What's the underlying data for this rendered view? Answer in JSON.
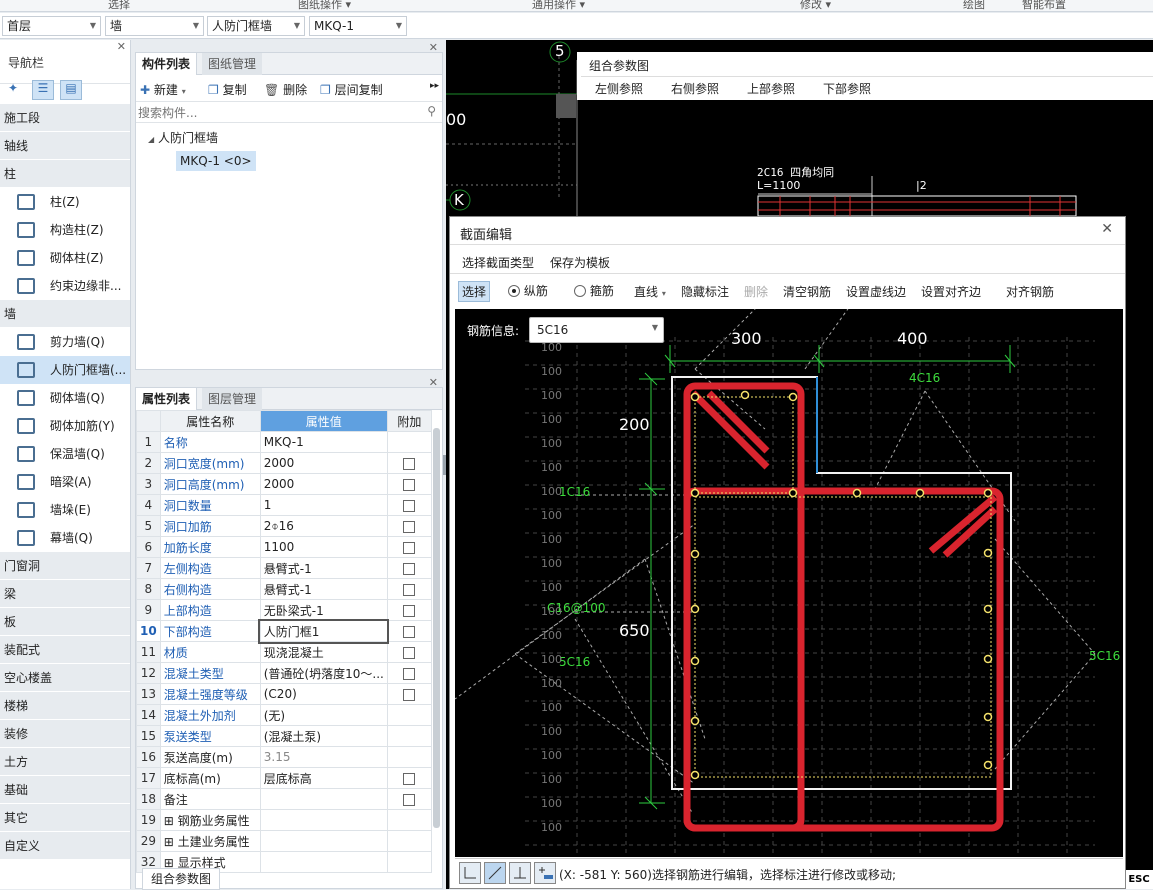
{
  "ribbon": [
    "选择",
    "图纸操作 ▾",
    "通用操作 ▾",
    "修改 ▾",
    "绘图",
    "智能布置"
  ],
  "selectors": {
    "floor": "首层",
    "category": "墙",
    "type": "人防门框墙",
    "instance": "MKQ-1"
  },
  "nav": {
    "title": "导航栏",
    "items": [
      {
        "kind": "sec",
        "label": "施工段"
      },
      {
        "kind": "sec",
        "label": "轴线"
      },
      {
        "kind": "sec",
        "label": "柱"
      },
      {
        "kind": "item",
        "label": "柱(Z)",
        "icon": "column-icon"
      },
      {
        "kind": "item",
        "label": "构造柱(Z)",
        "icon": "constructional-column-icon"
      },
      {
        "kind": "item",
        "label": "砌体柱(Z)",
        "icon": "masonry-column-icon"
      },
      {
        "kind": "item",
        "label": "约束边缘非...",
        "icon": "edge-member-icon"
      },
      {
        "kind": "sec",
        "label": "墙"
      },
      {
        "kind": "item",
        "label": "剪力墙(Q)",
        "icon": "shear-wall-icon"
      },
      {
        "kind": "item",
        "label": "人防门框墙(...",
        "icon": "civil-defense-door-wall-icon",
        "selected": true
      },
      {
        "kind": "item",
        "label": "砌体墙(Q)",
        "icon": "masonry-wall-icon"
      },
      {
        "kind": "item",
        "label": "砌体加筋(Y)",
        "icon": "masonry-rebar-icon"
      },
      {
        "kind": "item",
        "label": "保温墙(Q)",
        "icon": "insulation-wall-icon"
      },
      {
        "kind": "item",
        "label": "暗梁(A)",
        "icon": "hidden-beam-icon"
      },
      {
        "kind": "item",
        "label": "墙垛(E)",
        "icon": "wall-pier-icon"
      },
      {
        "kind": "item",
        "label": "幕墙(Q)",
        "icon": "curtain-wall-icon"
      },
      {
        "kind": "sec",
        "label": "门窗洞"
      },
      {
        "kind": "sec",
        "label": "梁"
      },
      {
        "kind": "sec",
        "label": "板"
      },
      {
        "kind": "sec",
        "label": "装配式"
      },
      {
        "kind": "sec",
        "label": "空心楼盖"
      },
      {
        "kind": "sec",
        "label": "楼梯"
      },
      {
        "kind": "sec",
        "label": "装修"
      },
      {
        "kind": "sec",
        "label": "土方"
      },
      {
        "kind": "sec",
        "label": "基础"
      },
      {
        "kind": "sec",
        "label": "其它"
      },
      {
        "kind": "sec",
        "label": "自定义"
      }
    ]
  },
  "components": {
    "tabs": [
      "构件列表",
      "图纸管理"
    ],
    "toolbar": [
      "新建",
      "复制",
      "删除",
      "层间复制"
    ],
    "search_placeholder": "搜索构件...",
    "tree_parent": "人防门框墙",
    "tree_child": "MKQ-1 <0>"
  },
  "properties": {
    "tabs": [
      "属性列表",
      "图层管理"
    ],
    "headers": [
      "属性名称",
      "属性值",
      "附加"
    ],
    "rows": [
      {
        "n": "1",
        "k": "名称",
        "v": "MKQ-1",
        "blue": true,
        "cb": false
      },
      {
        "n": "2",
        "k": "洞口宽度(mm)",
        "v": "2000",
        "blue": true,
        "cb": true
      },
      {
        "n": "3",
        "k": "洞口高度(mm)",
        "v": "2000",
        "blue": true,
        "cb": true
      },
      {
        "n": "4",
        "k": "洞口数量",
        "v": "1",
        "blue": true,
        "cb": true
      },
      {
        "n": "5",
        "k": "洞口加筋",
        "v": "2⌽16",
        "blue": true,
        "cb": true
      },
      {
        "n": "6",
        "k": "加筋长度",
        "v": "1100",
        "blue": true,
        "cb": true
      },
      {
        "n": "7",
        "k": "左侧构造",
        "v": "悬臂式-1",
        "blue": true,
        "cb": true
      },
      {
        "n": "8",
        "k": "右侧构造",
        "v": "悬臂式-1",
        "blue": true,
        "cb": true
      },
      {
        "n": "9",
        "k": "上部构造",
        "v": "无卧梁式-1",
        "blue": true,
        "cb": true
      },
      {
        "n": "10",
        "k": "下部构造",
        "v": "人防门框1",
        "blue": true,
        "cb": true,
        "edit": true
      },
      {
        "n": "11",
        "k": "材质",
        "v": "现浇混凝土",
        "blue": true,
        "cb": true
      },
      {
        "n": "12",
        "k": "混凝土类型",
        "v": "(普通砼(坍落度10～...",
        "blue": true,
        "cb": true
      },
      {
        "n": "13",
        "k": "混凝土强度等级",
        "v": "(C20)",
        "blue": true,
        "cb": true
      },
      {
        "n": "14",
        "k": "混凝土外加剂",
        "v": "(无)",
        "blue": true,
        "cb": false
      },
      {
        "n": "15",
        "k": "泵送类型",
        "v": "(混凝土泵)",
        "blue": true,
        "cb": false
      },
      {
        "n": "16",
        "k": "泵送高度(m)",
        "v": "3.15",
        "blue": false,
        "cb": false,
        "grey": true
      },
      {
        "n": "17",
        "k": "底标高(m)",
        "v": "层底标高",
        "blue": false,
        "cb": true
      },
      {
        "n": "18",
        "k": "备注",
        "v": "",
        "blue": false,
        "cb": true
      },
      {
        "n": "19",
        "k": "⊞ 钢筋业务属性",
        "v": "",
        "blue": false,
        "cb": false
      },
      {
        "n": "29",
        "k": "⊞ 土建业务属性",
        "v": "",
        "blue": false,
        "cb": false
      },
      {
        "n": "32",
        "k": "⊞ 显示样式",
        "v": "",
        "blue": false,
        "cb": false
      }
    ],
    "bottom_button": "组合参数图"
  },
  "main": {
    "axis_labels": [
      "5",
      "K"
    ],
    "partial_number": "00",
    "combo_title": "组合参数图",
    "combo_tabs": [
      "左侧参照",
      "右侧参照",
      "上部参照",
      "下部参照"
    ],
    "bg_rebar_label": "2C16 四角均同",
    "bg_length_label": "L=1100",
    "bg_mark": "|2"
  },
  "dialog": {
    "title": "截面编辑",
    "menu": [
      "选择截面类型",
      "保存为模板"
    ],
    "tools": {
      "select": "选择",
      "long": "纵筋",
      "stirrup": "箍筋",
      "line": "直线",
      "hide": "隐藏标注",
      "delete": "删除",
      "clear": "清空钢筋",
      "dashed": "设置虚线边",
      "align_edge": "设置对齐边",
      "align_rebar": "对齐钢筋"
    },
    "rebar_info_label": "钢筋信息:",
    "rebar_info_value": "5C16",
    "status_text": "(X: -581 Y: 560)选择钢筋进行编辑，选择标注进行修改或移动;",
    "drawing": {
      "dim_300": "300",
      "dim_400": "400",
      "dim_200": "200",
      "dim_650": "650",
      "grid_label": "100",
      "lbl_4c16": "4C16",
      "lbl_1c16": "1C16",
      "lbl_c16_100": "C16@100",
      "lbl_5c16_left": "5C16",
      "lbl_5c16_right": "5C16"
    }
  },
  "esc_label": "ESC"
}
